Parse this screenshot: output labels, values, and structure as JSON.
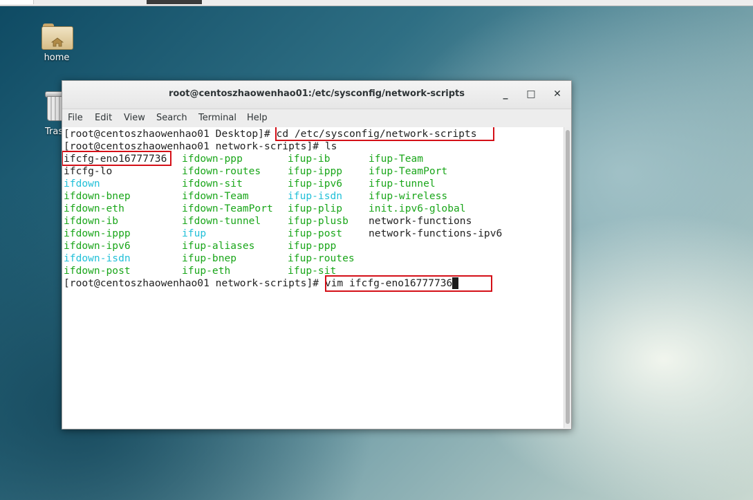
{
  "desktop": {
    "icons": [
      {
        "label": "home"
      },
      {
        "label": "Tras"
      }
    ]
  },
  "window": {
    "title": "root@centoszhaowenhao01:/etc/sysconfig/network-scripts",
    "buttons": {
      "minimize": "_",
      "maximize": "□",
      "close": "✕"
    }
  },
  "menu": [
    "File",
    "Edit",
    "View",
    "Search",
    "Terminal",
    "Help"
  ],
  "terminal": {
    "prompt1": "[root@centoszhaowenhao01 Desktop]# ",
    "cmd1": "cd /etc/sysconfig/network-scripts",
    "prompt2": "[root@centoszhaowenhao01 network-scripts]# ",
    "cmd2": "ls",
    "listing": [
      [
        "ifcfg-eno16777736",
        "ifdown-ppp",
        "ifup-ib",
        "ifup-Team"
      ],
      [
        "ifcfg-lo",
        "ifdown-routes",
        "ifup-ippp",
        "ifup-TeamPort"
      ],
      [
        "ifdown",
        "ifdown-sit",
        "ifup-ipv6",
        "ifup-tunnel"
      ],
      [
        "ifdown-bnep",
        "ifdown-Team",
        "ifup-isdn",
        "ifup-wireless"
      ],
      [
        "ifdown-eth",
        "ifdown-TeamPort",
        "ifup-plip",
        "init.ipv6-global"
      ],
      [
        "ifdown-ib",
        "ifdown-tunnel",
        "ifup-plusb",
        "network-functions"
      ],
      [
        "ifdown-ippp",
        "ifup",
        "ifup-post",
        "network-functions-ipv6"
      ],
      [
        "ifdown-ipv6",
        "ifup-aliases",
        "ifup-ppp",
        ""
      ],
      [
        "ifdown-isdn",
        "ifup-bnep",
        "ifup-routes",
        ""
      ],
      [
        "ifdown-post",
        "ifup-eth",
        "ifup-sit",
        ""
      ]
    ],
    "prompt3": "[root@centoszhaowenhao01 network-scripts]# ",
    "cmd3": "vim ifcfg-eno16777736"
  },
  "colors": {
    "executable": "#1aa61a",
    "symlink": "#21c0d8",
    "plain": "#222222",
    "highlight_box": "#d40f17"
  }
}
